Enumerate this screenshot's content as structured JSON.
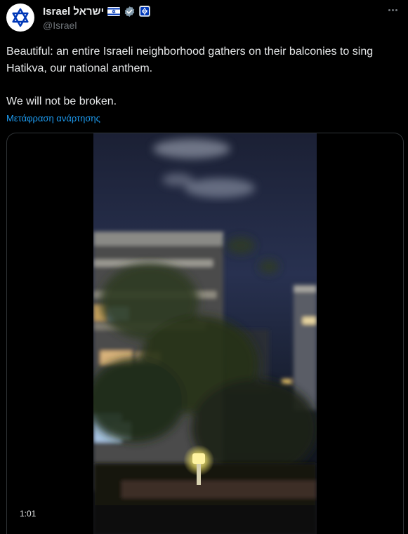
{
  "author": {
    "display_name": "Israel ישראל",
    "handle": "@Israel",
    "avatar_icon": "star-of-david-icon",
    "badges": [
      "israel-flag-icon",
      "verified-badge-icon",
      "government-org-badge-icon"
    ]
  },
  "menu": {
    "more_icon": "more-options-icon"
  },
  "tweet": {
    "text_line1": "Beautiful: an entire Israeli neighborhood gathers on their balconies to sing Hatikva, our national anthem.",
    "text_line2": "We will not be broken.",
    "translate_label": "Μετάφραση ανάρτησης"
  },
  "media": {
    "type": "video",
    "duration": "1:01"
  },
  "colors": {
    "background": "#000000",
    "text": "#e7e9ea",
    "secondary_text": "#71767b",
    "link": "#1d9bf0",
    "verified_badge": "#829aab"
  }
}
